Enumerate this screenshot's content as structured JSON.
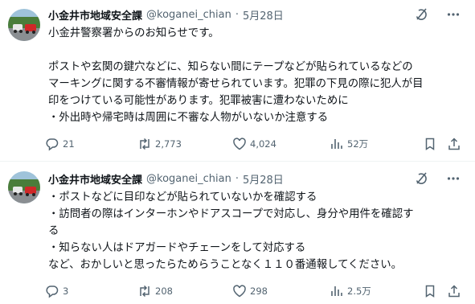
{
  "tweets": [
    {
      "author_name": "小金井市地域安全課",
      "handle": "@koganei_chian",
      "date": "5月28日",
      "lines": [
        "小金井警察署からのお知らせです。",
        "",
        "ポストや玄関の鍵穴などに、知らない間にテープなどが貼られているなどの",
        "マーキングに関する不審情報が寄せられています。犯罪の下見の際に犯人が目",
        "印をつけている可能性があります。犯罪被害に遭わないために",
        "・外出時や帰宅時は周囲に不審な人物がいないか注意する"
      ],
      "replies": "21",
      "reposts": "2,773",
      "likes": "4,024",
      "views": "52万"
    },
    {
      "author_name": "小金井市地域安全課",
      "handle": "@koganei_chian",
      "date": "5月28日",
      "lines": [
        "・ポストなどに目印などが貼られていないかを確認する",
        "・訪問者の際はインターホンやドアスコープで対応し、身分や用件を確認す",
        "る",
        "・知らない人はドアガードやチェーンをして対応する",
        "など、おかしいと思ったらためらうことなく１１０番通報してください。"
      ],
      "replies": "3",
      "reposts": "208",
      "likes": "298",
      "views": "2.5万"
    }
  ],
  "colors": {
    "text": "#0f1419",
    "secondary": "#536471",
    "border": "#eff3f4"
  },
  "icons": [
    "avatar",
    "grok-icon",
    "more-icon",
    "reply-icon",
    "repost-icon",
    "like-icon",
    "views-icon",
    "bookmark-icon",
    "share-icon"
  ]
}
